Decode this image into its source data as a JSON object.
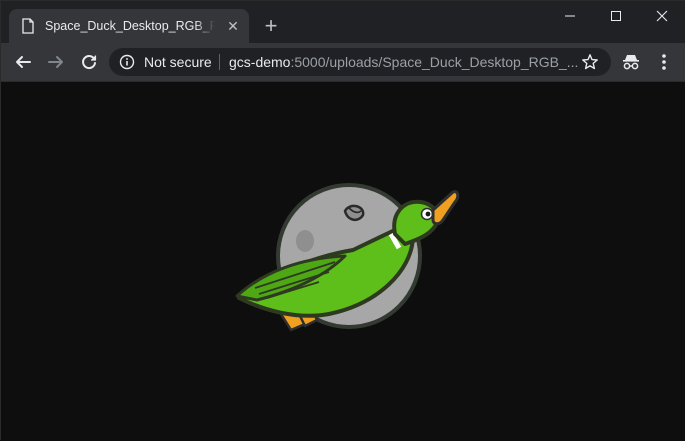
{
  "tab": {
    "title": "Space_Duck_Desktop_RGB_PNG.png",
    "close_glyph": "✕",
    "icon": "file-icon"
  },
  "new_tab_glyph": "+",
  "address_bar": {
    "security_label": "Not secure",
    "url_host": "gcs-demo",
    "url_rest": ":5000/uploads/Space_Duck_Desktop_RGB_..."
  },
  "icons": {
    "back": "back-arrow-icon",
    "forward": "forward-arrow-icon",
    "reload": "reload-icon",
    "info": "info-icon",
    "star": "bookmark-star-icon",
    "incognito": "incognito-icon",
    "menu": "kebab-menu-icon",
    "minimize": "minimize-icon",
    "maximize": "maximize-icon",
    "close": "window-close-icon"
  },
  "colors": {
    "titlebar": "#202124",
    "toolbar": "#35363a",
    "page_background": "#0e0e0e",
    "duck_green": "#5fbf1a",
    "moon_gray": "#a7a7a7",
    "beak_orange": "#f0a020"
  },
  "image": {
    "subject": "space duck over moon illustration"
  }
}
